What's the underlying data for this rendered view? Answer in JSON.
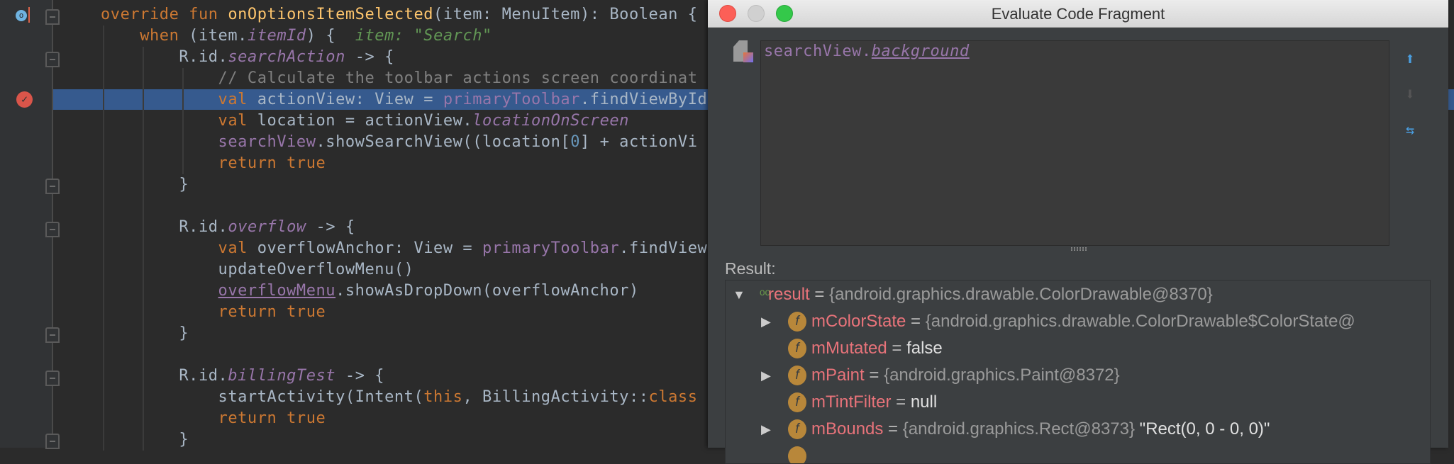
{
  "editor": {
    "lines": [
      [
        "override fun ",
        "onOptionsItemSelected",
        "(item: MenuItem): Boolean {"
      ],
      [
        "when",
        " (item.",
        "itemId",
        ") {  ",
        "item: \"Search\""
      ],
      [
        "R.id.",
        "searchAction",
        " -> {"
      ],
      [
        "// Calculate the toolbar actions screen coordinat"
      ],
      [
        "val",
        " actionView: View = ",
        "primaryToolbar",
        ".findViewById"
      ],
      [
        "val",
        " location = actionView.",
        "locationOnScreen"
      ],
      [
        "searchView",
        ".showSearchView((location[",
        "0",
        "] + actionVi"
      ],
      [
        "return true"
      ],
      [
        "}"
      ],
      [
        "R.id.",
        "overflow",
        " -> {"
      ],
      [
        "val",
        " overflowAnchor: View = ",
        "primaryToolbar",
        ".findView"
      ],
      [
        "updateOverflowMenu()"
      ],
      [
        "overflowMenu",
        ".showAsDropDown(overflowAnchor)"
      ],
      [
        "return true"
      ],
      [
        "}"
      ],
      [
        "R.id.",
        "billingTest",
        " -> {"
      ],
      [
        "startActivity(Intent(",
        "this",
        ", BillingActivity::",
        "class"
      ],
      [
        "return true"
      ],
      [
        "}"
      ]
    ]
  },
  "dialog": {
    "title": "Evaluate Code Fragment",
    "expression": [
      "searchView.",
      "background"
    ],
    "result_label": "Result:",
    "tree": [
      {
        "name": "result",
        "eq": " = ",
        "value": "{android.graphics.drawable.ColorDrawable@8370}",
        "extra": ""
      },
      {
        "name": "mColorState",
        "eq": " = ",
        "value": "{android.graphics.drawable.ColorDrawable$ColorState@",
        "extra": ""
      },
      {
        "name": "mMutated",
        "eq": " = ",
        "value": "",
        "extra": "false"
      },
      {
        "name": "mPaint",
        "eq": " = ",
        "value": "{android.graphics.Paint@8372}",
        "extra": ""
      },
      {
        "name": "mTintFilter",
        "eq": " = ",
        "value": "",
        "extra": "null"
      },
      {
        "name": "mBounds",
        "eq": " = ",
        "value": "{android.graphics.Rect@8373}",
        "extra": " \"Rect(0, 0 - 0, 0)\""
      }
    ],
    "field_icon": "f"
  }
}
